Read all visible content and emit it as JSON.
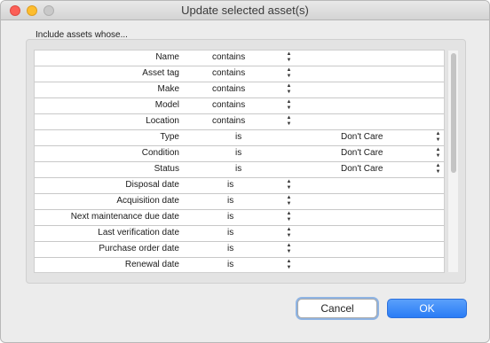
{
  "window": {
    "title": "Update selected asset(s)"
  },
  "group": {
    "label": "Include assets whose..."
  },
  "rows": [
    {
      "label": "Name",
      "operator": "contains",
      "value": ""
    },
    {
      "label": "Asset tag",
      "operator": "contains",
      "value": ""
    },
    {
      "label": "Make",
      "operator": "contains",
      "value": ""
    },
    {
      "label": "Model",
      "operator": "contains",
      "value": ""
    },
    {
      "label": "Location",
      "operator": "contains",
      "value": ""
    },
    {
      "label": "Type",
      "operator": "is",
      "value": "Don't Care"
    },
    {
      "label": "Condition",
      "operator": "is",
      "value": "Don't Care"
    },
    {
      "label": "Status",
      "operator": "is",
      "value": "Don't Care"
    },
    {
      "label": "Disposal date",
      "operator": "is",
      "value": ""
    },
    {
      "label": "Acquisition date",
      "operator": "is",
      "value": ""
    },
    {
      "label": "Next maintenance due date",
      "operator": "is",
      "value": ""
    },
    {
      "label": "Last verification date",
      "operator": "is",
      "value": ""
    },
    {
      "label": "Purchase order date",
      "operator": "is",
      "value": ""
    },
    {
      "label": "Renewal date",
      "operator": "is",
      "value": ""
    }
  ],
  "buttons": {
    "cancel": "Cancel",
    "ok": "OK"
  },
  "colors": {
    "accent": "#2a7cf5",
    "close": "#fc5f57",
    "minimize": "#fdbd2e"
  }
}
